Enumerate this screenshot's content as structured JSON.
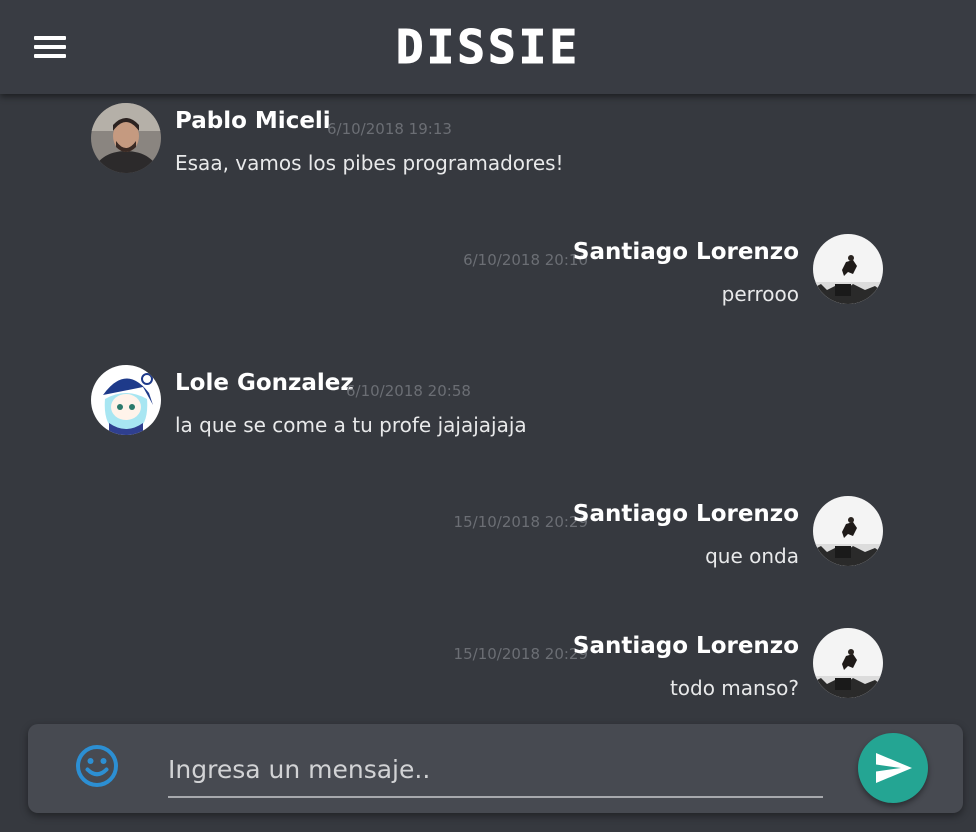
{
  "app": {
    "title": "DISSIE"
  },
  "icons": {
    "menu": "menu-icon",
    "emoji": "emoji-icon",
    "send": "send-icon"
  },
  "colors": {
    "background": "#36393f",
    "header": "#393c43",
    "composer": "#474a51",
    "send_button": "#24a593",
    "emoji_icon": "#2c8fd3",
    "timestamp": "#6b6e74"
  },
  "messages": [
    {
      "author": "Pablo Miceli",
      "time": "6/10/2018 19:13",
      "text": "Esaa, vamos los pibes programadores!",
      "side": "left"
    },
    {
      "author": "Santiago Lorenzo",
      "time": "6/10/2018 20:10",
      "text": "perrooo",
      "side": "right"
    },
    {
      "author": "Lole Gonzalez",
      "time": "6/10/2018 20:58",
      "text": "la que se come a tu profe jajajajaja",
      "side": "left"
    },
    {
      "author": "Santiago Lorenzo",
      "time": "15/10/2018 20:29",
      "text": "que onda",
      "side": "right"
    },
    {
      "author": "Santiago Lorenzo",
      "time": "15/10/2018 20:29",
      "text": "todo manso?",
      "side": "right"
    }
  ],
  "composer": {
    "placeholder": "Ingresa un mensaje..",
    "value": ""
  }
}
